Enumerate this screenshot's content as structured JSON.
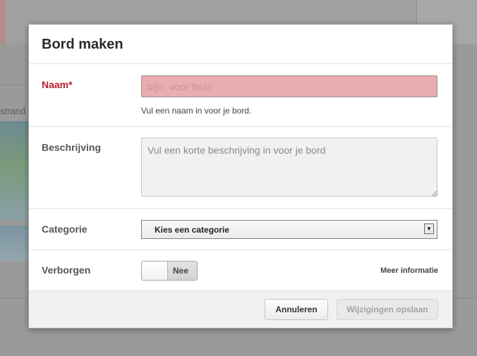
{
  "background": {
    "partial_text": "strand"
  },
  "modal": {
    "title": "Bord maken",
    "name": {
      "label": "Naam*",
      "placeholder": "bijv.: voor thuis",
      "hint": "Vul een naam in voor je bord."
    },
    "description": {
      "label": "Beschrijving",
      "placeholder": "Vul een korte beschrijving in voor je bord"
    },
    "category": {
      "label": "Categorie",
      "selected": "Kies een categorie"
    },
    "hidden": {
      "label": "Verborgen",
      "toggle_text": "Nee",
      "more_info": "Meer informatie"
    },
    "buttons": {
      "cancel": "Annuleren",
      "save": "Wijzigingen opslaan"
    }
  },
  "colors": {
    "error_label": "#b5202b",
    "error_input_bg": "#e8adaf",
    "overlay": "#9a9a9a"
  }
}
